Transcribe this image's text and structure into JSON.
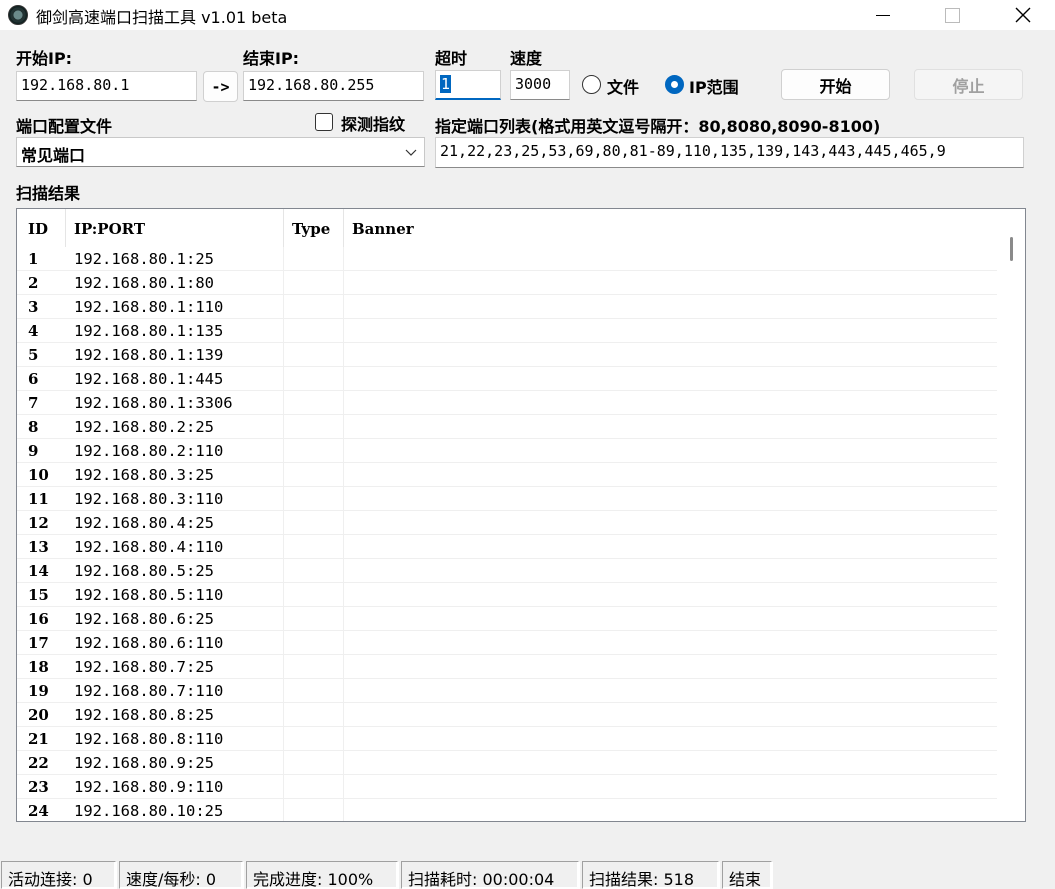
{
  "window": {
    "title": "御剑高速端口扫描工具 v1.01 beta"
  },
  "form": {
    "start_ip_label": "开始IP:",
    "start_ip_value": "192.168.80.1",
    "arrow_label": "->",
    "end_ip_label": "结束IP:",
    "end_ip_value": "192.168.80.255",
    "timeout_label": "超时",
    "timeout_value": "1",
    "speed_label": "速度",
    "speed_value": "3000",
    "radio_file_label": "文件",
    "radio_iprange_label": "IP范围",
    "mode_selected": "IP范围",
    "start_button": "开始",
    "stop_button": "停止",
    "port_config_label": "端口配置文件",
    "probe_fingerprint_label": "探测指纹",
    "probe_fingerprint_checked": false,
    "port_config_selected": "常见端口",
    "port_list_label": "指定端口列表(格式用英文逗号隔开：80,8080,8090-8100)",
    "port_list_value": "21,22,23,25,53,69,80,81-89,110,135,139,143,443,445,465,9"
  },
  "results": {
    "section_label": "扫描结果",
    "columns": [
      "ID",
      "IP:PORT",
      "Type",
      "Banner"
    ],
    "rows": [
      {
        "id": "1",
        "ipport": "192.168.80.1:25"
      },
      {
        "id": "2",
        "ipport": "192.168.80.1:80"
      },
      {
        "id": "3",
        "ipport": "192.168.80.1:110"
      },
      {
        "id": "4",
        "ipport": "192.168.80.1:135"
      },
      {
        "id": "5",
        "ipport": "192.168.80.1:139"
      },
      {
        "id": "6",
        "ipport": "192.168.80.1:445"
      },
      {
        "id": "7",
        "ipport": "192.168.80.1:3306"
      },
      {
        "id": "8",
        "ipport": "192.168.80.2:25"
      },
      {
        "id": "9",
        "ipport": "192.168.80.2:110"
      },
      {
        "id": "10",
        "ipport": "192.168.80.3:25"
      },
      {
        "id": "11",
        "ipport": "192.168.80.3:110"
      },
      {
        "id": "12",
        "ipport": "192.168.80.4:25"
      },
      {
        "id": "13",
        "ipport": "192.168.80.4:110"
      },
      {
        "id": "14",
        "ipport": "192.168.80.5:25"
      },
      {
        "id": "15",
        "ipport": "192.168.80.5:110"
      },
      {
        "id": "16",
        "ipport": "192.168.80.6:25"
      },
      {
        "id": "17",
        "ipport": "192.168.80.6:110"
      },
      {
        "id": "18",
        "ipport": "192.168.80.7:25"
      },
      {
        "id": "19",
        "ipport": "192.168.80.7:110"
      },
      {
        "id": "20",
        "ipport": "192.168.80.8:25"
      },
      {
        "id": "21",
        "ipport": "192.168.80.8:110"
      },
      {
        "id": "22",
        "ipport": "192.168.80.9:25"
      },
      {
        "id": "23",
        "ipport": "192.168.80.9:110"
      },
      {
        "id": "24",
        "ipport": "192.168.80.10:25"
      }
    ]
  },
  "status": {
    "active_connections": "活动连接: 0",
    "speed_per_sec": "速度/每秒: 0",
    "progress": "完成进度: 100%",
    "elapsed": "扫描耗时: 00:00:04",
    "result_count": "扫描结果: 518",
    "state": "结束"
  },
  "colors": {
    "accent": "#0067c0",
    "window_bg": "#f0f0f0"
  }
}
